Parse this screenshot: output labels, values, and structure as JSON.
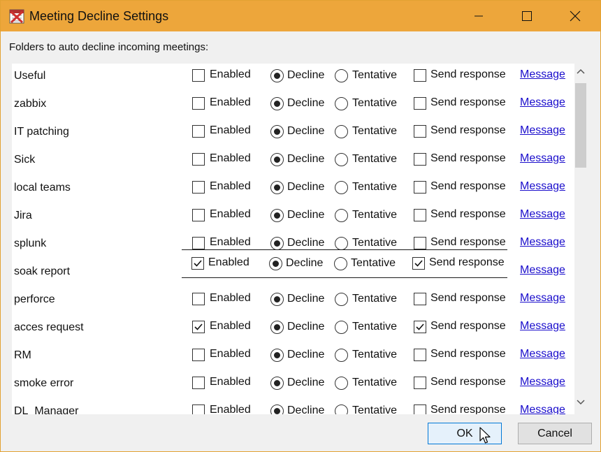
{
  "window": {
    "title": "Meeting Decline Settings",
    "icon": "calendar-decline-icon",
    "accent": "#eda63b"
  },
  "intro_text": "Folders to auto decline incoming meetings:",
  "options": {
    "enabled": "Enabled",
    "decline": "Decline",
    "tentative": "Tentative",
    "send_response": "Send response",
    "message": "Message"
  },
  "rows": [
    {
      "name": "Useful",
      "enabled": false,
      "mode": "decline",
      "send_response": false
    },
    {
      "name": "zabbix",
      "enabled": false,
      "mode": "decline",
      "send_response": false
    },
    {
      "name": "IT patching",
      "enabled": false,
      "mode": "decline",
      "send_response": false
    },
    {
      "name": "Sick",
      "enabled": false,
      "mode": "decline",
      "send_response": false
    },
    {
      "name": "local teams",
      "enabled": false,
      "mode": "decline",
      "send_response": false
    },
    {
      "name": "Jira",
      "enabled": false,
      "mode": "decline",
      "send_response": false
    },
    {
      "name": "splunk",
      "enabled": false,
      "mode": "decline",
      "send_response": false
    },
    {
      "name": "soak report",
      "enabled": true,
      "mode": "decline",
      "send_response": true,
      "editing": true
    },
    {
      "name": "perforce",
      "enabled": false,
      "mode": "decline",
      "send_response": false
    },
    {
      "name": "acces request",
      "enabled": true,
      "mode": "decline",
      "send_response": true
    },
    {
      "name": "RM",
      "enabled": false,
      "mode": "decline",
      "send_response": false
    },
    {
      "name": "smoke error",
      "enabled": false,
      "mode": "decline",
      "send_response": false
    },
    {
      "name": "DL_Manager",
      "enabled": false,
      "mode": "decline",
      "send_response": false
    }
  ],
  "buttons": {
    "ok": "OK",
    "cancel": "Cancel"
  }
}
